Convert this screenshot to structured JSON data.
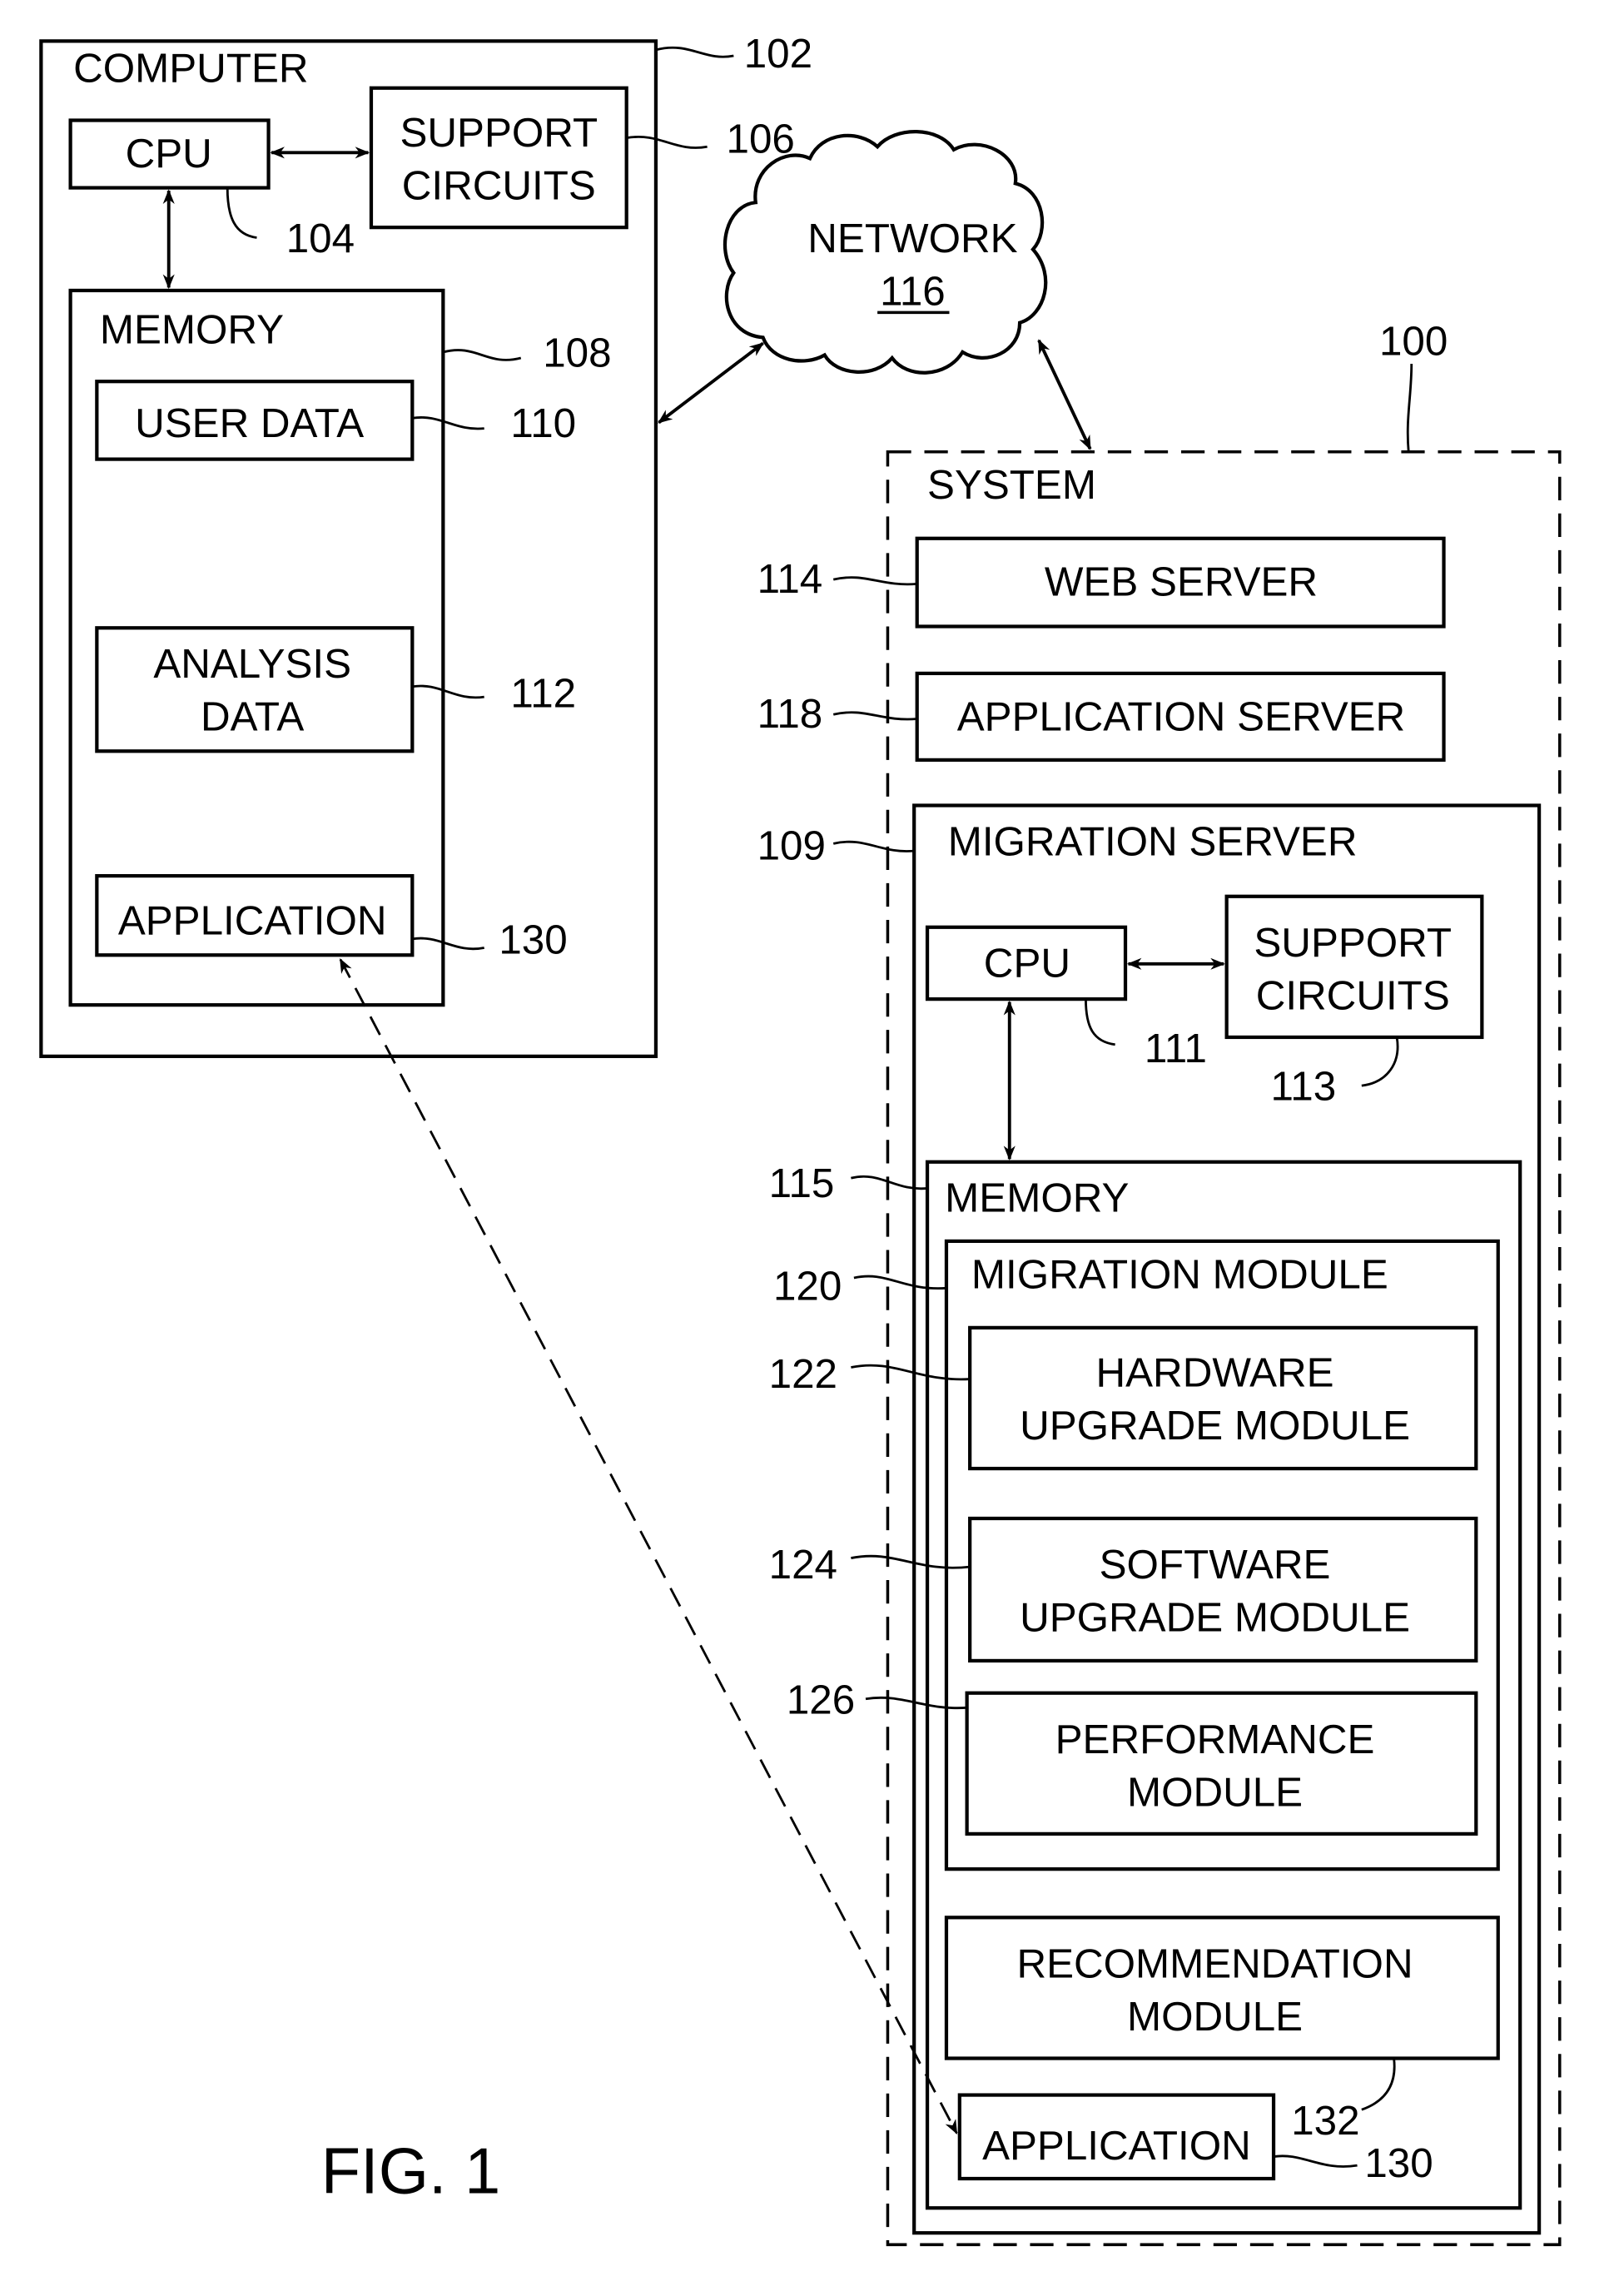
{
  "figure": {
    "caption": "FIG. 1",
    "system_ref": "100"
  },
  "computer": {
    "title": "COMPUTER",
    "ref": "102",
    "cpu": {
      "label": "CPU",
      "ref": "104"
    },
    "support": {
      "line1": "SUPPORT",
      "line2": "CIRCUITS",
      "ref": "106"
    },
    "memory": {
      "title": "MEMORY",
      "ref": "108",
      "user_data": {
        "label": "USER DATA",
        "ref": "110"
      },
      "analysis_data": {
        "line1": "ANALYSIS",
        "line2": "DATA",
        "ref": "112"
      },
      "application": {
        "label": "APPLICATION",
        "ref": "130"
      }
    }
  },
  "network": {
    "label": "NETWORK",
    "ref": "116"
  },
  "system": {
    "title": "SYSTEM",
    "web_server": {
      "label": "WEB SERVER",
      "ref": "114"
    },
    "app_server": {
      "label": "APPLICATION SERVER",
      "ref": "118"
    },
    "migration_server": {
      "title": "MIGRATION SERVER",
      "ref": "109",
      "cpu": {
        "label": "CPU",
        "ref": "111"
      },
      "support": {
        "line1": "SUPPORT",
        "line2": "CIRCUITS",
        "ref": "113"
      },
      "memory": {
        "title": "MEMORY",
        "ref": "115",
        "migration_module": {
          "title": "MIGRATION MODULE",
          "ref": "120",
          "hardware": {
            "line1": "HARDWARE",
            "line2": "UPGRADE MODULE",
            "ref": "122"
          },
          "software": {
            "line1": "SOFTWARE",
            "line2": "UPGRADE MODULE",
            "ref": "124"
          },
          "performance": {
            "line1": "PERFORMANCE",
            "line2": "MODULE",
            "ref": "126"
          }
        },
        "recommendation": {
          "line1": "RECOMMENDATION",
          "line2": "MODULE",
          "ref": "132"
        },
        "application": {
          "label": "APPLICATION",
          "ref": "130"
        }
      }
    }
  }
}
